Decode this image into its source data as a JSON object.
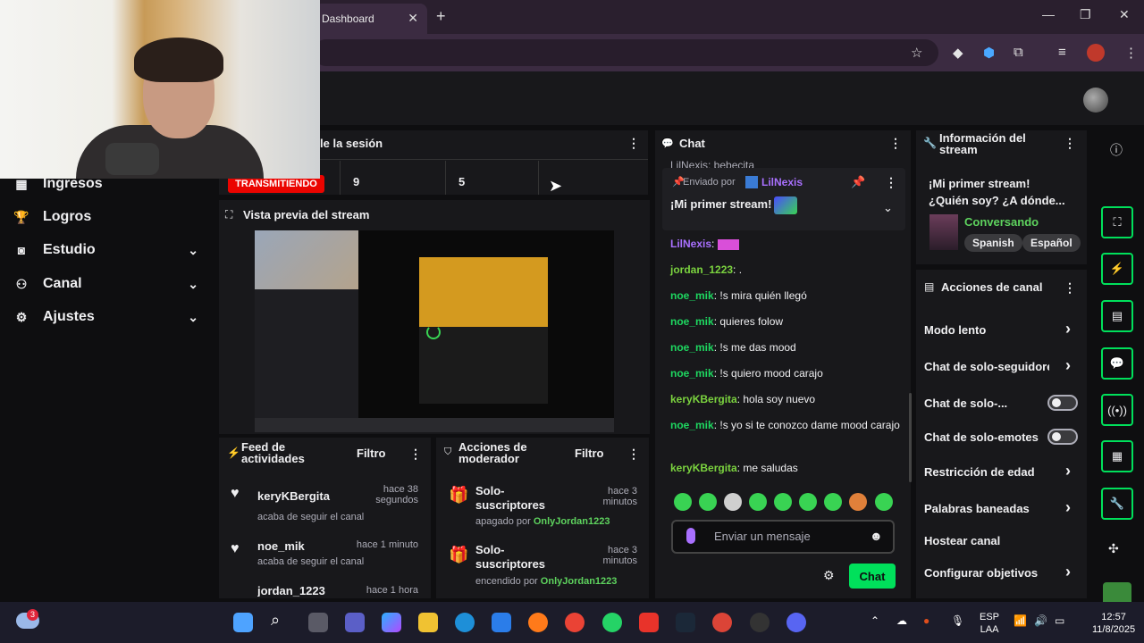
{
  "browser": {
    "tab_title": "Dashboard",
    "tab_close": "✕",
    "new_tab": "+",
    "minimize": "—",
    "maximize": "❐",
    "close": "✕"
  },
  "sidebar": {
    "items": [
      {
        "label": "Ingresos"
      },
      {
        "label": "Logros"
      },
      {
        "label": "Estudio"
      },
      {
        "label": "Canal"
      },
      {
        "label": "Ajustes"
      }
    ]
  },
  "session": {
    "title": "le la sesión",
    "status": "TRANSMITIENDO",
    "stat1": "9",
    "stat2": "5"
  },
  "preview": {
    "title": "Vista previa del stream"
  },
  "activity": {
    "title_line1": "Feed de",
    "title_line2": "actividades",
    "filter": "Filtro",
    "items": [
      {
        "name": "keryKBergita",
        "action": "acaba de seguir el canal",
        "time_line1": "hace 38",
        "time_line2": "segundos"
      },
      {
        "name": "noe_mik",
        "action": "acaba de seguir el canal",
        "time_line1": "hace 1 minuto",
        "time_line2": ""
      },
      {
        "name": "jordan_1223",
        "action": "",
        "time_line1": "hace 1 hora",
        "time_line2": ""
      }
    ]
  },
  "mod_actions": {
    "title_line1": "Acciones de",
    "title_line2": "moderador",
    "filter": "Filtro",
    "items": [
      {
        "title_line1": "Solo-",
        "title_line2": "suscriptores",
        "detail": "apagado por",
        "user": "OnlyJordan1223",
        "time_line1": "hace 3",
        "time_line2": "minutos"
      },
      {
        "title_line1": "Solo-",
        "title_line2": "suscriptores",
        "detail": "encendido por",
        "user": "OnlyJordan1223",
        "time_line1": "hace 3",
        "time_line2": "minutos"
      }
    ]
  },
  "chat": {
    "title": "Chat",
    "partial_top": "LilNexis: bebecita",
    "pinned_label": "Enviado por",
    "pinned_user": "LilNexis",
    "pinned_message": "¡Mi primer stream!",
    "messages": [
      {
        "user": "LilNexis",
        "text": "",
        "cls": "u-lil"
      },
      {
        "user": "jordan_1223",
        "text": ".",
        "cls": "u-jordan"
      },
      {
        "user": "noe_mik",
        "text": "!s mira quién llegó",
        "cls": "u-noe"
      },
      {
        "user": "noe_mik",
        "text": "quieres folow",
        "cls": "u-noe"
      },
      {
        "user": "noe_mik",
        "text": "!s me das mood",
        "cls": "u-noe"
      },
      {
        "user": "noe_mik",
        "text": "!s quiero mood carajo",
        "cls": "u-noe"
      },
      {
        "user": "keryKBergita",
        "text": "hola soy nuevo",
        "cls": "u-kery"
      },
      {
        "user": "noe_mik",
        "text": "!s yo si te conozco dame mood carajo",
        "cls": "u-noe"
      },
      {
        "user": "keryKBergita",
        "text": "me saludas",
        "cls": "u-kery"
      }
    ],
    "input_placeholder": "Enviar un mensaje",
    "send_label": "Chat"
  },
  "stream_info": {
    "title_line1": "Información del",
    "title_line2": "stream",
    "stream_title_line1": "¡Mi primer stream!",
    "stream_title_line2": "¿Quién soy? ¿A dónde...",
    "category": "Conversando",
    "tags": [
      "Spanish",
      "Español"
    ]
  },
  "channel_actions": {
    "title": "Acciones de canal",
    "items": [
      {
        "label": "Modo lento",
        "control": "chevron"
      },
      {
        "label": "Chat de solo-seguidores",
        "control": "chevron"
      },
      {
        "label": "Chat de solo-...",
        "control": "toggle"
      },
      {
        "label": "Chat de solo-emotes",
        "control": "toggle"
      },
      {
        "label": "Restricción de edad",
        "control": "chevron"
      },
      {
        "label": "Palabras baneadas",
        "control": "chevron"
      },
      {
        "label": "Hostear canal",
        "control": "none"
      },
      {
        "label": "Configurar objetivos",
        "control": "chevron"
      }
    ]
  },
  "taskbar": {
    "weather_badge": "3",
    "lang_line1": "ESP",
    "lang_line2": "LAA",
    "time": "12:57",
    "date": "11/8/2025"
  },
  "colors": {
    "accent": "#00e05b",
    "live": "#eb0400",
    "brand": "#a970ff"
  }
}
